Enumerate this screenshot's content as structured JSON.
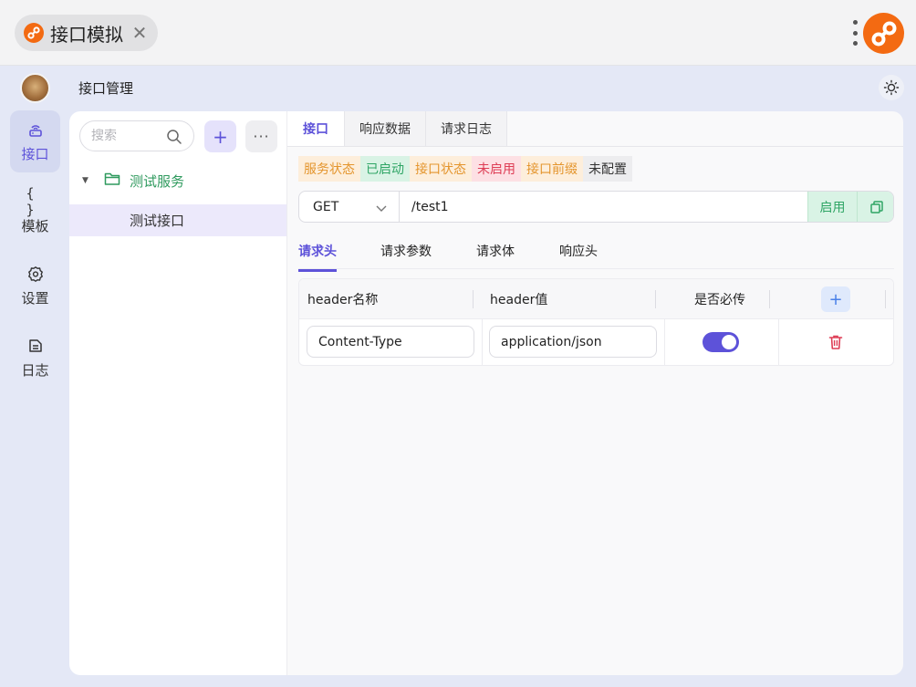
{
  "window": {
    "tab_title": "接口模拟",
    "tab_close": "✕",
    "brand_color": "#f36a12"
  },
  "header": {
    "title": "接口管理"
  },
  "sidebar": {
    "items": [
      {
        "label": "接口",
        "icon": "wifi-router-icon",
        "active": true
      },
      {
        "label": "模板",
        "icon": "braces-icon",
        "glyph": "{ }",
        "active": false
      },
      {
        "label": "设置",
        "icon": "gear-icon",
        "active": false
      },
      {
        "label": "日志",
        "icon": "log-icon",
        "active": false
      }
    ]
  },
  "tree": {
    "search_placeholder": "搜索",
    "add_label": "+",
    "more_label": "···",
    "folder": "测试服务",
    "leaf": "测试接口"
  },
  "main": {
    "tabs": [
      "接口",
      "响应数据",
      "请求日志"
    ],
    "active_tab": "接口",
    "status": [
      {
        "text": "服务状态",
        "tone": "orange"
      },
      {
        "text": "已启动",
        "tone": "green"
      },
      {
        "text": "接口状态",
        "tone": "orange"
      },
      {
        "text": "未启用",
        "tone": "red"
      },
      {
        "text": "接口前缀",
        "tone": "orange"
      },
      {
        "text": "未配置",
        "tone": "gray"
      }
    ],
    "method": "GET",
    "url": "/test1",
    "enable_label": "启用",
    "sub_tabs": [
      "请求头",
      "请求参数",
      "请求体",
      "响应头"
    ],
    "active_sub_tab": "请求头",
    "table": {
      "headers": [
        "header名称",
        "header值",
        "是否必传"
      ],
      "add_label": "+",
      "rows": [
        {
          "name": "Content-Type",
          "value": "application/json",
          "required": true
        }
      ]
    }
  },
  "colors": {
    "accent": "#5d52d9",
    "success": "#2fa565",
    "warning": "#e4952d",
    "danger": "#de3d55"
  }
}
